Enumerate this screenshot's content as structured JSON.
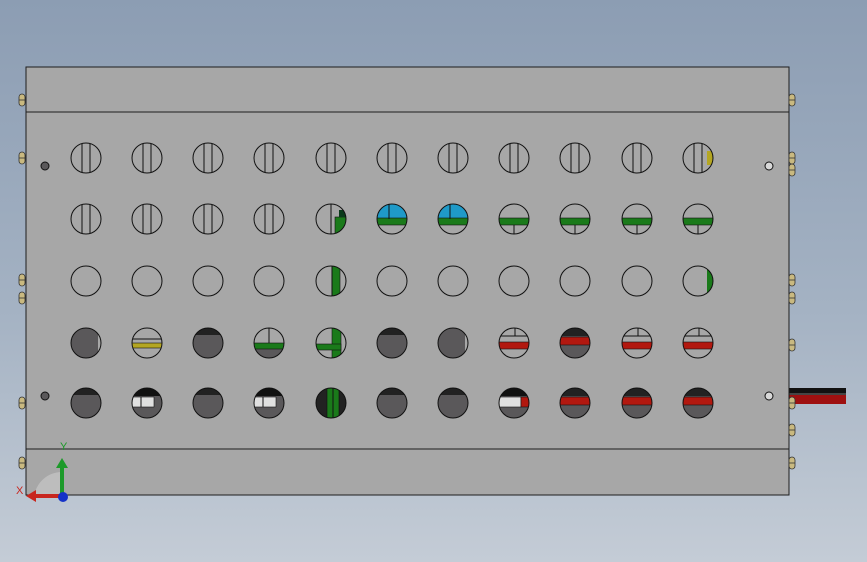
{
  "axis_triad": {
    "x_label": "X",
    "y_label": "Y"
  },
  "colors": {
    "panel": "#a7a7a7",
    "edge": "#1d1d1d",
    "dark_hole": "#5a585a",
    "green": "#1a7a1a",
    "red": "#b2180f",
    "yellow": "#b4a622",
    "cyan": "#1f9ac8",
    "wire_red": "#9e1010",
    "wire_black": "#111111"
  },
  "hole_rows": [
    [
      "slit",
      "slit",
      "slit",
      "slit",
      "slit",
      "slit",
      "slit",
      "slit",
      "slit",
      "slit",
      "slit-yellow"
    ],
    [
      "slit",
      "slit",
      "slit",
      "slit",
      "green-corner",
      "cyan-green",
      "cyan-green",
      "green-bar",
      "green-bar",
      "green-bar",
      "green-bar"
    ],
    [
      "plain",
      "plain",
      "plain",
      "plain",
      "green-vertical",
      "plain",
      "plain",
      "plain",
      "plain",
      "plain",
      "green-edge"
    ],
    [
      "dark-notch",
      "yellow-bar",
      "dark",
      "dark-green",
      "green-L",
      "dark",
      "dark-notch",
      "red-bar",
      "dark-red",
      "red-bar",
      "red-bar"
    ],
    [
      "dark",
      "dark-white",
      "dark",
      "dark-white",
      "green-vertical-dark",
      "dark",
      "dark",
      "dark-white-red",
      "dark-red",
      "dark-red",
      "dark-red"
    ]
  ]
}
